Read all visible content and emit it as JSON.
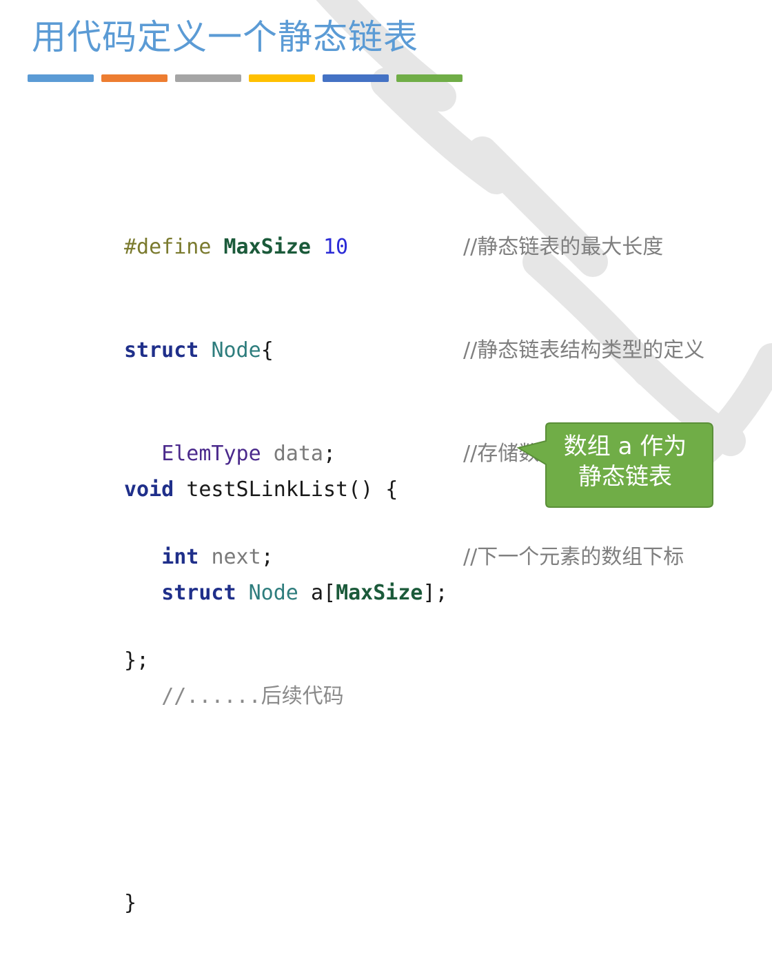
{
  "slide": {
    "title": "用代码定义一个静态链表",
    "title_bar_colors": [
      "#5b9bd5",
      "#ed7d31",
      "#a5a5a5",
      "#ffc000",
      "#4472c4",
      "#70ad47"
    ]
  },
  "code_block1": {
    "line1": {
      "directive": "#define",
      "macro": "MaxSize",
      "value": "10"
    },
    "line2": {
      "keyword": "struct",
      "type": "Node",
      "brace": "{"
    },
    "line3": {
      "type": "ElemType",
      "field": "data",
      "semi": ";"
    },
    "line4": {
      "keyword": "int",
      "field": "next",
      "semi": ";"
    },
    "line5": {
      "close": "};"
    }
  },
  "comments": [
    "//静态链表的最大长度",
    "//静态链表结构类型的定义",
    "//存储数据元素",
    "//下一个元素的数组下标"
  ],
  "code_block2": {
    "line1": {
      "keyword": "void",
      "rest": "testSLinkList() {"
    },
    "line2": {
      "keyword": "struct",
      "type": "Node",
      "var": "a",
      "open": "[",
      "macro": "MaxSize",
      "close": "];"
    },
    "line3": {
      "comment": "//......后续代码"
    },
    "line4": {
      "close": "}"
    }
  },
  "callout": {
    "line1": "数组 a 作为",
    "line2": "静态链表",
    "fill": "#70ad47",
    "border": "#5a8f38"
  }
}
